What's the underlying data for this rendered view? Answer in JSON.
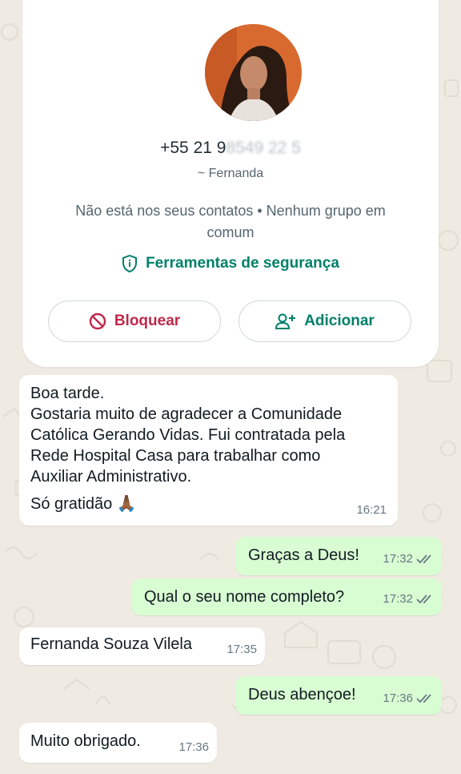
{
  "contact_card": {
    "phone_visible": "+55 21 9",
    "phone_redacted": "8549 22 5",
    "pushname": "~ Fernanda",
    "status_text": "Não está nos seus contatos • Nenhum grupo em comum",
    "safety_tools_label": "Ferramentas de segurança",
    "block_label": "Bloquear",
    "add_label": "Adicionar"
  },
  "messages": [
    {
      "direction": "in",
      "lines": [
        "Boa tarde.",
        "Gostaria muito de agradecer a Comunidade",
        "Católica Gerando Vidas. Fui contratada pela",
        "Rede Hospital Casa para trabalhar como",
        "Auxiliar Administrativo."
      ],
      "last_line": "Só gratidão 🙏🏾",
      "time": "16:21"
    },
    {
      "direction": "out",
      "text": "Graças a Deus!",
      "time": "17:32",
      "read": true
    },
    {
      "direction": "out",
      "text": "Qual o seu nome completo?",
      "time": "17:32",
      "read": true
    },
    {
      "direction": "in",
      "text": "Fernanda Souza Vilela",
      "time": "17:35"
    },
    {
      "direction": "out",
      "text": "Deus abençoe!",
      "time": "17:36",
      "read": true
    },
    {
      "direction": "in",
      "text": "Muito obrigado.",
      "time": "17:36"
    }
  ],
  "colors": {
    "chat_background": "#efeae2",
    "incoming_bubble": "#ffffff",
    "outgoing_bubble": "#d9fdd3",
    "accent_green": "#008069",
    "block_red": "#c0284a"
  }
}
